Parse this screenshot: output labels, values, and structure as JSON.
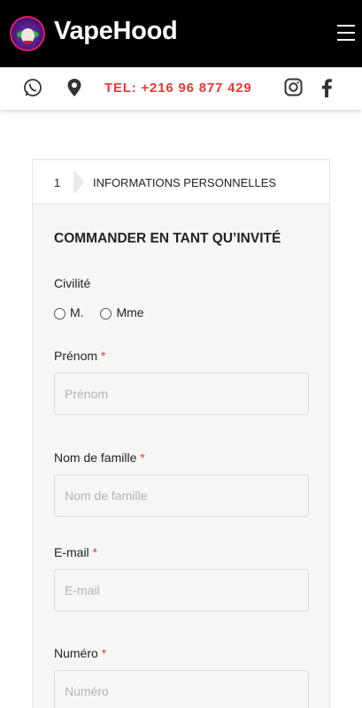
{
  "header": {
    "brand": "VapeHood",
    "logo_icon": "joker-logo-icon",
    "menu_icon": "hamburger-menu-icon",
    "background": "#000000"
  },
  "contact_bar": {
    "icons": [
      "whatsapp-icon",
      "location-pin-icon",
      "instagram-icon",
      "facebook-icon"
    ],
    "phone": "TEL: +216 96 877 429",
    "phone_color": "#e53935"
  },
  "checkout": {
    "step": {
      "number": "1",
      "title": "INFORMATIONS PERSONNELLES"
    },
    "section_title": "COMMANDER EN TANT QU’INVITÉ",
    "civility": {
      "label": "Civilité",
      "options": [
        "M.",
        "Mme"
      ]
    },
    "fields": [
      {
        "label": "Prénom",
        "required": "*",
        "placeholder": "Prénom",
        "value": ""
      },
      {
        "label": "Nom de famille",
        "required": "*",
        "placeholder": "Nom de famille",
        "value": ""
      },
      {
        "label": "E-mail",
        "required": "*",
        "placeholder": "E-mail",
        "value": ""
      },
      {
        "label": "Numéro",
        "required": "*",
        "placeholder": "Numéro",
        "value": ""
      }
    ]
  }
}
